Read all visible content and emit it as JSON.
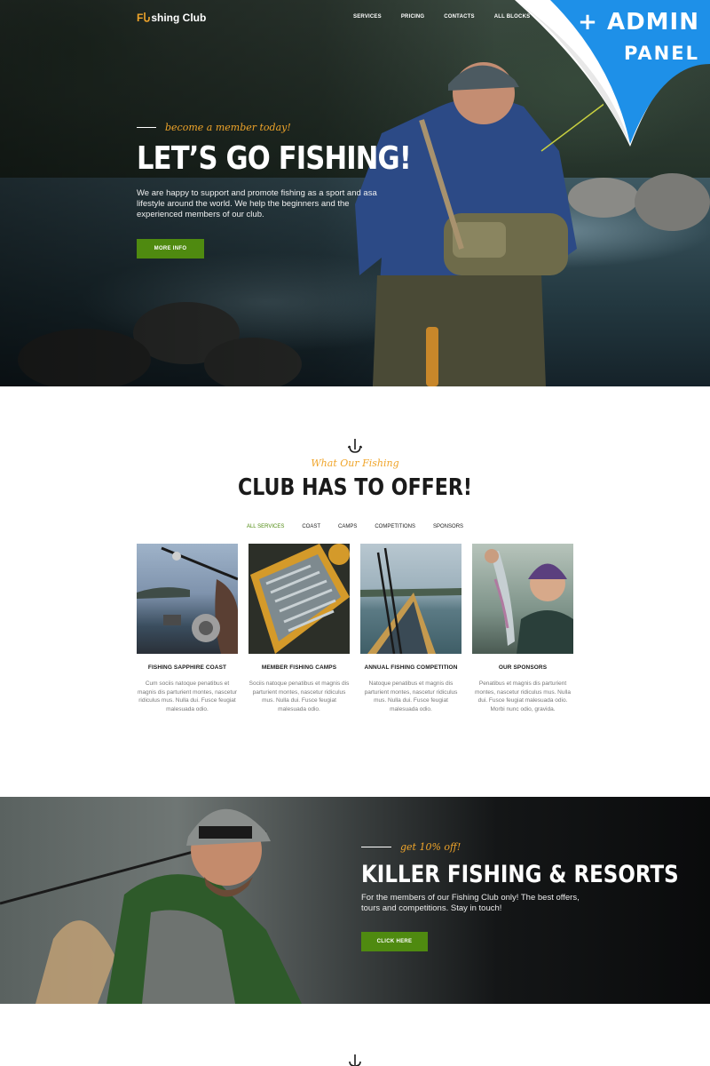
{
  "nav": {
    "logo_prefix": "F",
    "logo_rest": "shing Club",
    "items": [
      "SERVICES",
      "PRICING",
      "CONTACTS",
      "ALL BLOCKS"
    ]
  },
  "hero": {
    "tagline": "become a member today!",
    "title": "LET’S GO FISHING!",
    "text": "We are happy to support and promote fishing as a sport and asa lifestyle around the world. We help the beginners and the experienced members of our club.",
    "button": "MORE INFO"
  },
  "admin_badge": {
    "line1": "+ ADMIN",
    "line2": "PANEL"
  },
  "offer": {
    "subtitle": "What Our Fishing",
    "title": "CLUB HAS TO OFFER!",
    "tabs": [
      "ALL SERVICES",
      "COAST",
      "CAMPS",
      "COMPETITIONS",
      "SPONSORS"
    ],
    "active_tab": "ALL SERVICES",
    "cards": [
      {
        "title": "FISHING SAPPHIRE COAST",
        "text": "Cum sociis natoque penatibus et magnis dis parturient montes, nascetur ridiculus mus. Nulla dui. Fusce feugiat malesuada odio."
      },
      {
        "title": "MEMBER FISHING CAMPS",
        "text": "Sociis natoque penatibus et magnis dis parturient montes, nascetur ridiculus mus. Nulla dui. Fusce feugiat malesuada odio."
      },
      {
        "title": "ANNUAL FISHING COMPETITION",
        "text": "Natoque penatibus et magnis dis parturient montes, nascetur ridiculus mus. Nulla dui. Fusce feugiat malesuada odio."
      },
      {
        "title": "OUR SPONSORS",
        "text": "Penatibus et magnis dis parturient montes, nascetur ridiculus mus. Nulla dui. Fusce feugiat malesuada odio. Morbi nunc odio, gravida."
      }
    ]
  },
  "promo": {
    "tagline": "get 10% off!",
    "title": "KILLER FISHING & RESORTS",
    "text": "For the members of our Fishing Club only! The best offers, tours and competitions. Stay in touch!",
    "button": "CLICK HERE"
  },
  "colors": {
    "accent_green": "#4f8a10",
    "accent_orange": "#f0a52a",
    "admin_blue": "#1e90e8"
  }
}
